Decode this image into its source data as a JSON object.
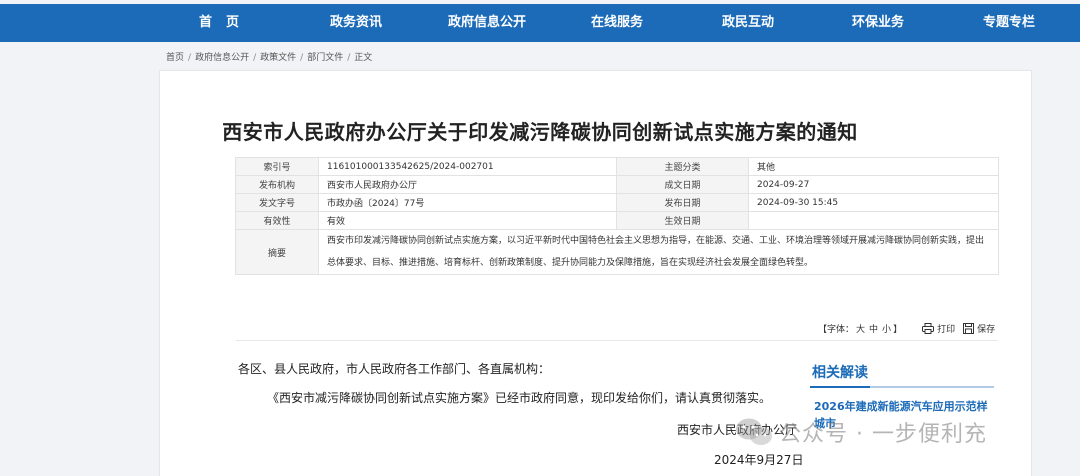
{
  "nav": {
    "items": [
      {
        "label": "首页"
      },
      {
        "label": "政务资讯"
      },
      {
        "label": "政府信息公开"
      },
      {
        "label": "在线服务"
      },
      {
        "label": "政民互动"
      },
      {
        "label": "环保业务"
      },
      {
        "label": "专题专栏"
      }
    ]
  },
  "breadcrumb": [
    "首页",
    "政府信息公开",
    "政策文件",
    "部门文件",
    "正文"
  ],
  "document": {
    "title": "西安市人民政府办公厅关于印发减污降碳协同创新试点实施方案的通知"
  },
  "meta": {
    "index_label": "索引号",
    "index_value": "116101000133542625/2024-002701",
    "topic_label": "主题分类",
    "topic_value": "其他",
    "issuer_label": "发布机构",
    "issuer_value": "西安市人民政府办公厅",
    "created_label": "成文日期",
    "created_value": "2024-09-27",
    "docno_label": "发文字号",
    "docno_value": "市政办函〔2024〕77号",
    "published_label": "发布日期",
    "published_value": "2024-09-30 15:45",
    "validity_label": "有效性",
    "validity_value": "有效",
    "effective_label": "生效日期",
    "effective_value": "",
    "abstract_label": "摘要",
    "abstract_value": "西安市印发减污降碳协同创新试点实施方案，以习近平新时代中国特色社会主义思想为指导，在能源、交通、工业、环境治理等领域开展减污降碳协同创新实践，提出总体要求、目标、推进措施、培育标杆、创新政策制度、提升协同能力及保障措施，旨在实现经济社会发展全面绿色转型。"
  },
  "toolbar": {
    "font_prefix": "【字体：",
    "font_large": "大",
    "font_medium": "中",
    "font_small": "小",
    "font_suffix": "】",
    "print_label": "打印",
    "save_label": "保存"
  },
  "body": {
    "salutation": "各区、县人民政府，市人民政府各工作部门、各直属机构：",
    "paragraph": "《西安市减污降碳协同创新试点实施方案》已经市政府同意，现印发给你们，请认真贯彻落实。",
    "signature": "西安市人民政府办公厅",
    "date": "2024年9月27日"
  },
  "related": {
    "title": "相关解读",
    "link": "2026年建成新能源汽车应用示范样城市"
  },
  "watermark": {
    "text": "公众号 · 一步便利充"
  },
  "colors": {
    "nav_bg": "#1b6bb8",
    "accent": "#1b6bb8"
  }
}
